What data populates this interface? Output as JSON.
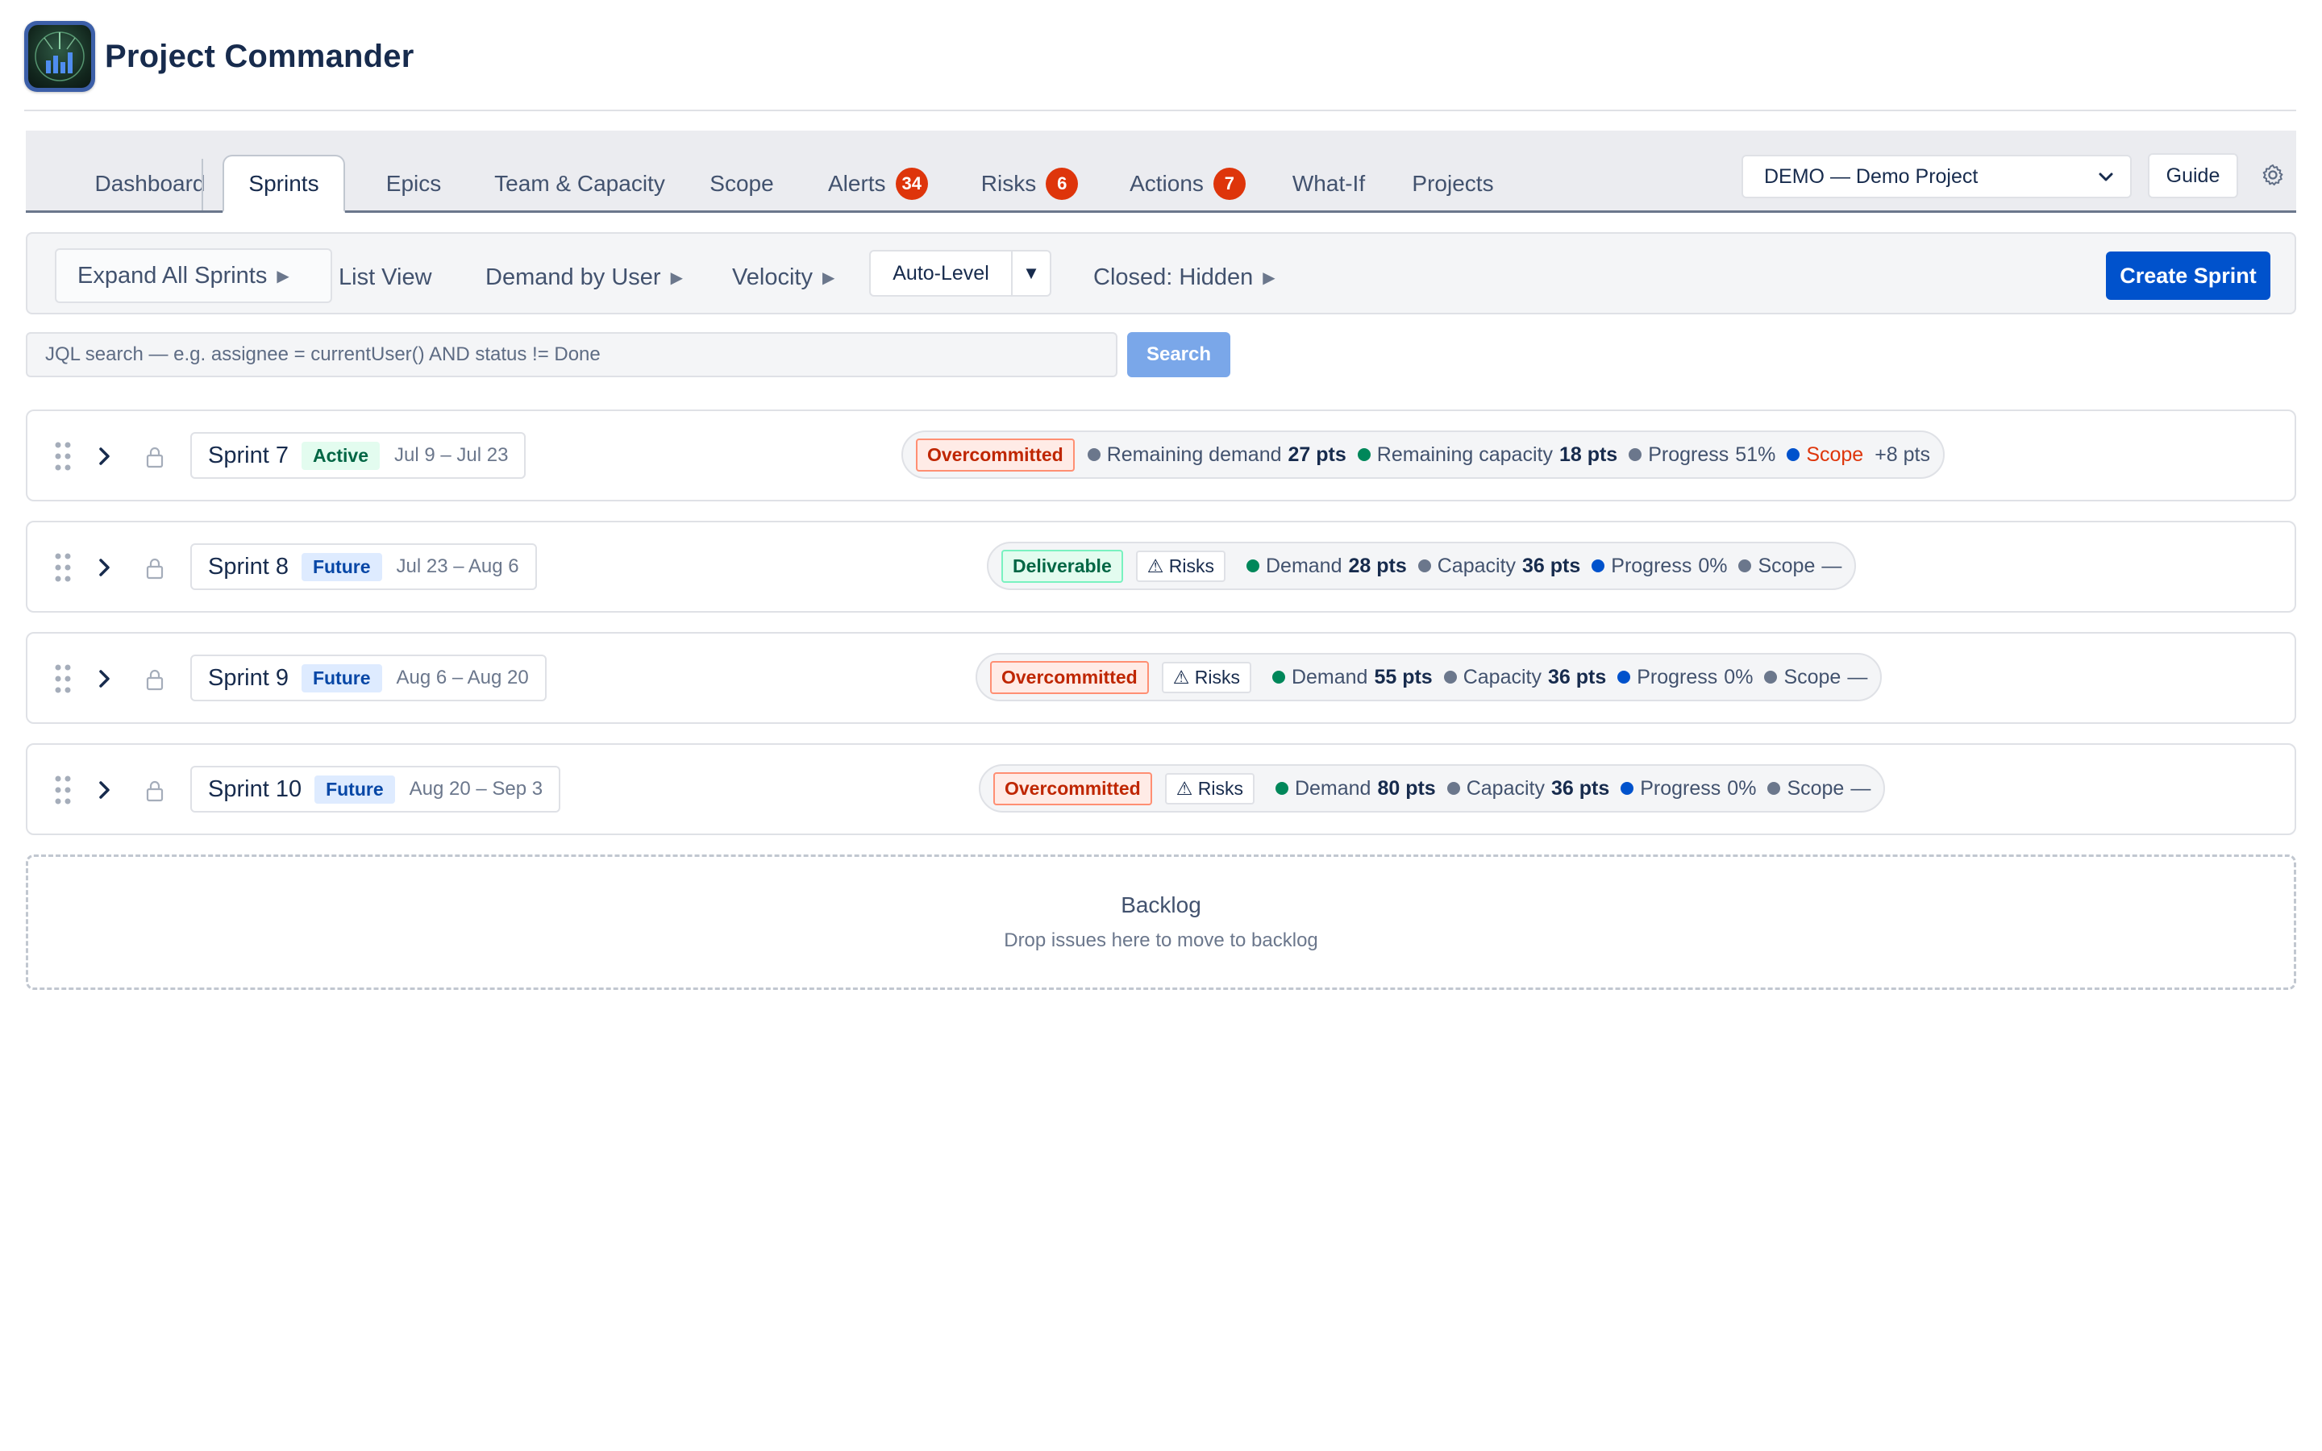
{
  "app": {
    "title": "Project Commander"
  },
  "tabs": [
    {
      "label": "Dashboard",
      "active": false
    },
    {
      "label": "Sprints",
      "active": true
    },
    {
      "label": "Epics",
      "active": false
    },
    {
      "label": "Team & Capacity",
      "active": false
    },
    {
      "label": "Scope",
      "active": false
    },
    {
      "label": "Alerts",
      "badge": "34"
    },
    {
      "label": "Risks",
      "badge": "6"
    },
    {
      "label": "Actions",
      "badge": "7"
    },
    {
      "label": "What-If",
      "active": false
    },
    {
      "label": "Projects",
      "active": false
    }
  ],
  "header_controls": {
    "project_select": "DEMO — Demo Project",
    "guide_label": "Guide",
    "settings_icon": "gear-icon"
  },
  "toolbar": {
    "expand_all": "Expand All Sprints",
    "list_view": "List View",
    "demand_by_user": "Demand by User",
    "velocity": "Velocity",
    "auto_level": "Auto-Level",
    "auto_level_caret": "▼",
    "closed": "Closed: Hidden",
    "toggle_arrow": "▶",
    "create_sprint": "Create Sprint"
  },
  "search": {
    "placeholder": "JQL search — e.g. assignee = currentUser() AND status != Done",
    "button": "Search"
  },
  "sprints": [
    {
      "name": "Sprint 7",
      "state": "Active",
      "dates": "Jul 9 – Jul 23",
      "status": "Overcommitted",
      "risks": null,
      "demand_label": "Remaining demand",
      "demand": "27 pts",
      "capacity_label": "Remaining capacity",
      "capacity": "18 pts",
      "progress_label": "Progress",
      "progress": "51%",
      "scope_label": "Scope",
      "scope": "+8 pts"
    },
    {
      "name": "Sprint 8",
      "state": "Future",
      "dates": "Jul 23 – Aug 6",
      "status": "Deliverable",
      "risks": "⚠ Risks",
      "demand_label": "Demand",
      "demand": "28 pts",
      "capacity_label": "Capacity",
      "capacity": "36 pts",
      "progress_label": "Progress",
      "progress": "0%",
      "scope_label": "Scope",
      "scope": "—"
    },
    {
      "name": "Sprint 9",
      "state": "Future",
      "dates": "Aug 6 – Aug 20",
      "status": "Overcommitted",
      "risks": "⚠ Risks",
      "demand_label": "Demand",
      "demand": "55 pts",
      "capacity_label": "Capacity",
      "capacity": "36 pts",
      "progress_label": "Progress",
      "progress": "0%",
      "scope_label": "Scope",
      "scope": "—"
    },
    {
      "name": "Sprint 10",
      "state": "Future",
      "dates": "Aug 20 – Sep 3",
      "status": "Overcommitted",
      "risks": "⚠ Risks",
      "demand_label": "Demand",
      "demand": "80 pts",
      "capacity_label": "Capacity",
      "capacity": "36 pts",
      "progress_label": "Progress",
      "progress": "0%",
      "scope_label": "Scope",
      "scope": "—"
    }
  ],
  "backlog": {
    "title": "Backlog",
    "hint": "Drop issues here to move to backlog"
  },
  "colors": {
    "primary": "#0052cc",
    "danger": "#de350b",
    "success": "#00875a",
    "muted": "#6b778c"
  }
}
